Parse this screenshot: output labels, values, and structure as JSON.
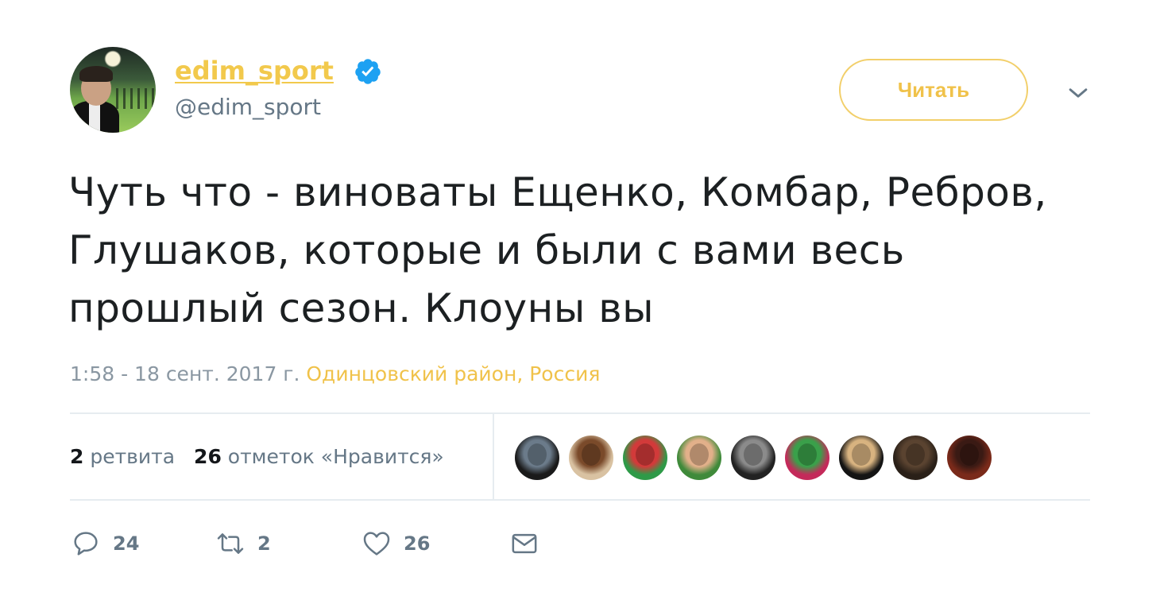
{
  "user": {
    "display_name": "edim_sport",
    "handle": "@edim_sport",
    "verified": true
  },
  "follow_button": {
    "label": "Читать"
  },
  "tweet": {
    "text": "Чуть что - виноваты Ещенко, Комбар, Ребров, Глушаков, которые и были с вами весь прошлый сезон. Клоуны вы",
    "time": "1:58 - 18 сент. 2017 г.",
    "location": "Одинцовский район, Россия"
  },
  "stats": {
    "retweets_count": "2",
    "retweets_label": "ретвита",
    "likes_count": "26",
    "likes_label": "отметок «Нравится»"
  },
  "liker_avatars": [
    {
      "colors": [
        "#1a1a1a",
        "#6b7b8a"
      ]
    },
    {
      "colors": [
        "#d9c2a2",
        "#7a4a2a"
      ]
    },
    {
      "colors": [
        "#2e9a48",
        "#d23a3a"
      ]
    },
    {
      "colors": [
        "#3f8a3a",
        "#e2b08a"
      ]
    },
    {
      "colors": [
        "#222222",
        "#8b8b8b"
      ]
    },
    {
      "colors": [
        "#c42a5a",
        "#3aa04a"
      ]
    },
    {
      "colors": [
        "#141414",
        "#d8b380"
      ]
    },
    {
      "colors": [
        "#2a2018",
        "#5a4330"
      ]
    },
    {
      "colors": [
        "#7a2a1a",
        "#3a1a14"
      ]
    }
  ],
  "actions": {
    "reply_count": "24",
    "retweet_count": "2",
    "like_count": "26"
  },
  "colors": {
    "accent": "#f2c94c",
    "verified_badge": "#1da1f2",
    "secondary_text": "#657786"
  }
}
